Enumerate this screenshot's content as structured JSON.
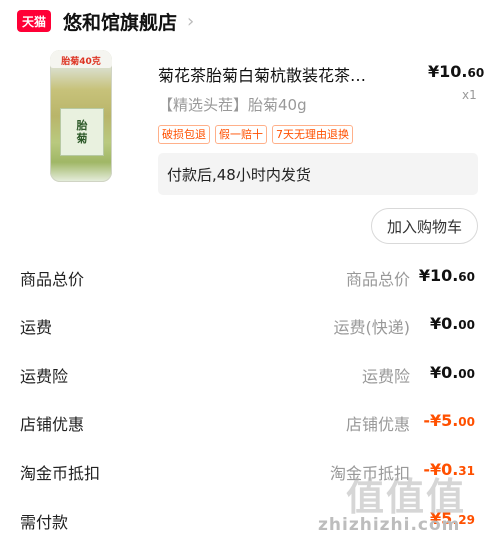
{
  "shop": {
    "badge": "天猫",
    "name": "悠和馆旗舰店",
    "chevron": "›"
  },
  "product": {
    "image_cap_text": "胎菊40克",
    "image_label_line1": "胎",
    "image_label_line2": "菊",
    "title": "菊花茶胎菊白菊杭散装花茶…",
    "spec": "【精选头茬】胎菊40g",
    "price_main": "¥10.",
    "price_cents": "60",
    "quantity": "x1",
    "tags": [
      "破损包退",
      "假一赔十",
      "7天无理由退换"
    ],
    "shipping_note": "付款后,48小时内发货",
    "cart_button": "加入购物车"
  },
  "summary": [
    {
      "label": "商品总价",
      "sub": "商品总价",
      "val_main": "¥10.",
      "val_cents": "60",
      "discount": false
    },
    {
      "label": "运费",
      "sub": "运费(快递)",
      "val_main": "¥0.",
      "val_cents": "00",
      "discount": false
    },
    {
      "label": "运费险",
      "sub": "运费险",
      "val_main": "¥0.",
      "val_cents": "00",
      "discount": false
    },
    {
      "label": "店铺优惠",
      "sub": "店铺优惠",
      "val_main": "-¥5.",
      "val_cents": "00",
      "discount": true
    },
    {
      "label": "淘金币抵扣",
      "sub": "淘金币抵扣",
      "val_main": "-¥0.",
      "val_cents": "31",
      "discount": true
    },
    {
      "label": "需付款",
      "sub": "",
      "val_main": "¥5.",
      "val_cents": "29",
      "discount": false
    }
  ],
  "watermark": {
    "text": "zhizhizhi.com",
    "cn": "值值值"
  },
  "colors": {
    "tmall_red": "#ff0036",
    "accent_orange": "#ff5000"
  }
}
